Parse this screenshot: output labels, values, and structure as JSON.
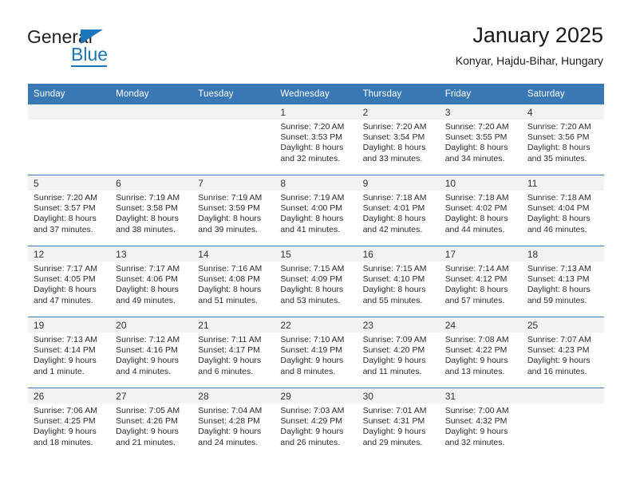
{
  "brand": {
    "name_part1": "General",
    "name_part2": "Blue"
  },
  "header": {
    "title": "January 2025",
    "subtitle": "Konyar, Hajdu-Bihar, Hungary"
  },
  "colors": {
    "header_blue": "#3a78b5",
    "brand_blue": "#1b75bb",
    "daynum_band": "#f2f2f2"
  },
  "weekdays": [
    "Sunday",
    "Monday",
    "Tuesday",
    "Wednesday",
    "Thursday",
    "Friday",
    "Saturday"
  ],
  "weeks": [
    [
      {
        "day": "",
        "sunrise": "",
        "sunset": "",
        "daylight1": "",
        "daylight2": ""
      },
      {
        "day": "",
        "sunrise": "",
        "sunset": "",
        "daylight1": "",
        "daylight2": ""
      },
      {
        "day": "",
        "sunrise": "",
        "sunset": "",
        "daylight1": "",
        "daylight2": ""
      },
      {
        "day": "1",
        "sunrise": "Sunrise: 7:20 AM",
        "sunset": "Sunset: 3:53 PM",
        "daylight1": "Daylight: 8 hours",
        "daylight2": "and 32 minutes."
      },
      {
        "day": "2",
        "sunrise": "Sunrise: 7:20 AM",
        "sunset": "Sunset: 3:54 PM",
        "daylight1": "Daylight: 8 hours",
        "daylight2": "and 33 minutes."
      },
      {
        "day": "3",
        "sunrise": "Sunrise: 7:20 AM",
        "sunset": "Sunset: 3:55 PM",
        "daylight1": "Daylight: 8 hours",
        "daylight2": "and 34 minutes."
      },
      {
        "day": "4",
        "sunrise": "Sunrise: 7:20 AM",
        "sunset": "Sunset: 3:56 PM",
        "daylight1": "Daylight: 8 hours",
        "daylight2": "and 35 minutes."
      }
    ],
    [
      {
        "day": "5",
        "sunrise": "Sunrise: 7:20 AM",
        "sunset": "Sunset: 3:57 PM",
        "daylight1": "Daylight: 8 hours",
        "daylight2": "and 37 minutes."
      },
      {
        "day": "6",
        "sunrise": "Sunrise: 7:19 AM",
        "sunset": "Sunset: 3:58 PM",
        "daylight1": "Daylight: 8 hours",
        "daylight2": "and 38 minutes."
      },
      {
        "day": "7",
        "sunrise": "Sunrise: 7:19 AM",
        "sunset": "Sunset: 3:59 PM",
        "daylight1": "Daylight: 8 hours",
        "daylight2": "and 39 minutes."
      },
      {
        "day": "8",
        "sunrise": "Sunrise: 7:19 AM",
        "sunset": "Sunset: 4:00 PM",
        "daylight1": "Daylight: 8 hours",
        "daylight2": "and 41 minutes."
      },
      {
        "day": "9",
        "sunrise": "Sunrise: 7:18 AM",
        "sunset": "Sunset: 4:01 PM",
        "daylight1": "Daylight: 8 hours",
        "daylight2": "and 42 minutes."
      },
      {
        "day": "10",
        "sunrise": "Sunrise: 7:18 AM",
        "sunset": "Sunset: 4:02 PM",
        "daylight1": "Daylight: 8 hours",
        "daylight2": "and 44 minutes."
      },
      {
        "day": "11",
        "sunrise": "Sunrise: 7:18 AM",
        "sunset": "Sunset: 4:04 PM",
        "daylight1": "Daylight: 8 hours",
        "daylight2": "and 46 minutes."
      }
    ],
    [
      {
        "day": "12",
        "sunrise": "Sunrise: 7:17 AM",
        "sunset": "Sunset: 4:05 PM",
        "daylight1": "Daylight: 8 hours",
        "daylight2": "and 47 minutes."
      },
      {
        "day": "13",
        "sunrise": "Sunrise: 7:17 AM",
        "sunset": "Sunset: 4:06 PM",
        "daylight1": "Daylight: 8 hours",
        "daylight2": "and 49 minutes."
      },
      {
        "day": "14",
        "sunrise": "Sunrise: 7:16 AM",
        "sunset": "Sunset: 4:08 PM",
        "daylight1": "Daylight: 8 hours",
        "daylight2": "and 51 minutes."
      },
      {
        "day": "15",
        "sunrise": "Sunrise: 7:15 AM",
        "sunset": "Sunset: 4:09 PM",
        "daylight1": "Daylight: 8 hours",
        "daylight2": "and 53 minutes."
      },
      {
        "day": "16",
        "sunrise": "Sunrise: 7:15 AM",
        "sunset": "Sunset: 4:10 PM",
        "daylight1": "Daylight: 8 hours",
        "daylight2": "and 55 minutes."
      },
      {
        "day": "17",
        "sunrise": "Sunrise: 7:14 AM",
        "sunset": "Sunset: 4:12 PM",
        "daylight1": "Daylight: 8 hours",
        "daylight2": "and 57 minutes."
      },
      {
        "day": "18",
        "sunrise": "Sunrise: 7:13 AM",
        "sunset": "Sunset: 4:13 PM",
        "daylight1": "Daylight: 8 hours",
        "daylight2": "and 59 minutes."
      }
    ],
    [
      {
        "day": "19",
        "sunrise": "Sunrise: 7:13 AM",
        "sunset": "Sunset: 4:14 PM",
        "daylight1": "Daylight: 9 hours",
        "daylight2": "and 1 minute."
      },
      {
        "day": "20",
        "sunrise": "Sunrise: 7:12 AM",
        "sunset": "Sunset: 4:16 PM",
        "daylight1": "Daylight: 9 hours",
        "daylight2": "and 4 minutes."
      },
      {
        "day": "21",
        "sunrise": "Sunrise: 7:11 AM",
        "sunset": "Sunset: 4:17 PM",
        "daylight1": "Daylight: 9 hours",
        "daylight2": "and 6 minutes."
      },
      {
        "day": "22",
        "sunrise": "Sunrise: 7:10 AM",
        "sunset": "Sunset: 4:19 PM",
        "daylight1": "Daylight: 9 hours",
        "daylight2": "and 8 minutes."
      },
      {
        "day": "23",
        "sunrise": "Sunrise: 7:09 AM",
        "sunset": "Sunset: 4:20 PM",
        "daylight1": "Daylight: 9 hours",
        "daylight2": "and 11 minutes."
      },
      {
        "day": "24",
        "sunrise": "Sunrise: 7:08 AM",
        "sunset": "Sunset: 4:22 PM",
        "daylight1": "Daylight: 9 hours",
        "daylight2": "and 13 minutes."
      },
      {
        "day": "25",
        "sunrise": "Sunrise: 7:07 AM",
        "sunset": "Sunset: 4:23 PM",
        "daylight1": "Daylight: 9 hours",
        "daylight2": "and 16 minutes."
      }
    ],
    [
      {
        "day": "26",
        "sunrise": "Sunrise: 7:06 AM",
        "sunset": "Sunset: 4:25 PM",
        "daylight1": "Daylight: 9 hours",
        "daylight2": "and 18 minutes."
      },
      {
        "day": "27",
        "sunrise": "Sunrise: 7:05 AM",
        "sunset": "Sunset: 4:26 PM",
        "daylight1": "Daylight: 9 hours",
        "daylight2": "and 21 minutes."
      },
      {
        "day": "28",
        "sunrise": "Sunrise: 7:04 AM",
        "sunset": "Sunset: 4:28 PM",
        "daylight1": "Daylight: 9 hours",
        "daylight2": "and 24 minutes."
      },
      {
        "day": "29",
        "sunrise": "Sunrise: 7:03 AM",
        "sunset": "Sunset: 4:29 PM",
        "daylight1": "Daylight: 9 hours",
        "daylight2": "and 26 minutes."
      },
      {
        "day": "30",
        "sunrise": "Sunrise: 7:01 AM",
        "sunset": "Sunset: 4:31 PM",
        "daylight1": "Daylight: 9 hours",
        "daylight2": "and 29 minutes."
      },
      {
        "day": "31",
        "sunrise": "Sunrise: 7:00 AM",
        "sunset": "Sunset: 4:32 PM",
        "daylight1": "Daylight: 9 hours",
        "daylight2": "and 32 minutes."
      },
      {
        "day": "",
        "sunrise": "",
        "sunset": "",
        "daylight1": "",
        "daylight2": ""
      }
    ]
  ]
}
